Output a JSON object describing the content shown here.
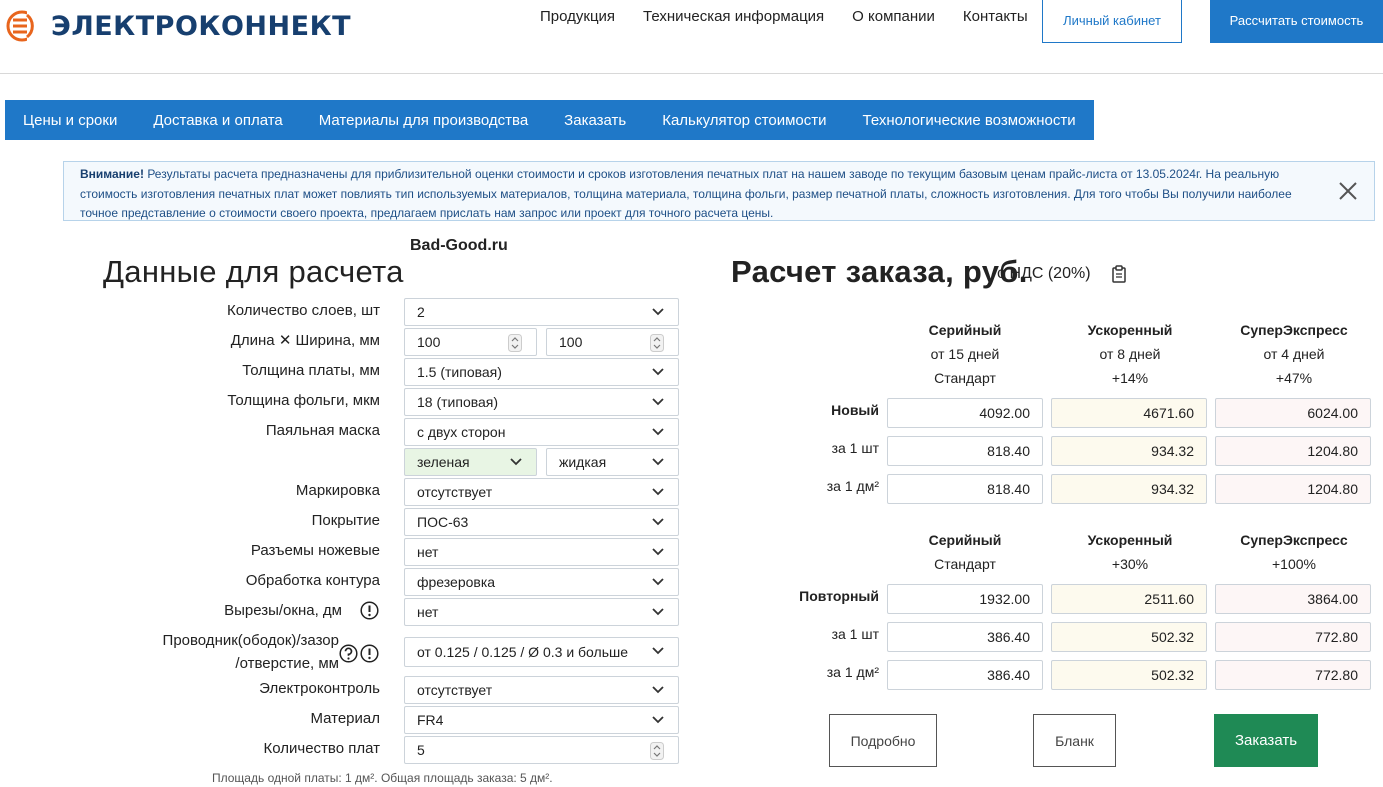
{
  "brand": {
    "name": "ЭЛЕКТРОКОННЕКТ",
    "logo_icon": "logo-mark-icon",
    "color": "#173f6f",
    "accent": "#e8651d"
  },
  "topnav": [
    "Продукция",
    "Техническая информация",
    "О компании",
    "Контакты"
  ],
  "header_buttons": {
    "cabinet": "Личный кабинет",
    "calculate": "Рассчитать стоимость"
  },
  "subnav": [
    "Цены и сроки",
    "Доставка и оплата",
    "Материалы для производства",
    "Заказать",
    "Калькулятор стоимости",
    "Технологические возможности"
  ],
  "alert": {
    "strong": "Внимание!",
    "text": " Результаты расчета предназначены для приблизительной оценки стоимости и сроков изготовления печатных плат на нашем заводе по текущим базовым ценам прайс-листа от 13.05.2024г. На реальную стоимость изготовления печатных плат может повлиять тип используемых материалов, толщина материала, толщина фольги, размер печатной платы, сложность изготовления. Для того чтобы Вы получили наиболее точное представление о стоимости своего проекта, предлагаем прислать нам запрос или проект для точного расчета цены."
  },
  "watermark": "Bad-Good.ru",
  "form": {
    "title": "Данные для расчета",
    "layers_label": "Количество слоев, шт",
    "layers_value": "2",
    "size_label": "Длина ✕ Ширина, мм",
    "length_value": "100",
    "width_value": "100",
    "thickness_label": "Толщина платы, мм",
    "thickness_value": "1.5 (типовая)",
    "foil_label": "Толщина фольги, мкм",
    "foil_value": "18 (типовая)",
    "mask_label": "Паяльная маска",
    "mask_sides_value": "с двух сторон",
    "mask_color_value": "зеленая",
    "mask_type_value": "жидкая",
    "marking_label": "Маркировка",
    "marking_value": "отсутствует",
    "coating_label": "Покрытие",
    "coating_value": "ПОС-63",
    "connectors_label": "Разъемы ножевые",
    "connectors_value": "нет",
    "contour_label": "Обработка контура",
    "contour_value": "фрезеровка",
    "cutouts_label": "Вырезы/окна, дм",
    "cutouts_value": "нет",
    "conductor_label_1": "Проводник(ободок)/зазор",
    "conductor_label_2": "/отверстие, мм",
    "conductor_value": "от 0.125 / 0.125 / Ø 0.3 и больше",
    "etest_label": "Электроконтроль",
    "etest_value": "отсутствует",
    "material_label": "Материал",
    "material_value": "FR4",
    "qty_label": "Количество плат",
    "qty_value": "5",
    "footnote": "Площадь одной платы: 1 дм². Общая площадь заказа: 5 дм²."
  },
  "calc": {
    "title": "Расчет заказа, руб.",
    "vat": "с НДС (20%)",
    "new_columns": [
      {
        "name": "Серийный",
        "term": "от 15 дней",
        "extra": "Стандарт"
      },
      {
        "name": "Ускоренный",
        "term": "от 8 дней",
        "extra": "+14%"
      },
      {
        "name": "СуперЭкспресс",
        "term": "от 4 дней",
        "extra": "+47%"
      }
    ],
    "new_rows": [
      {
        "label": "Новый",
        "values": [
          "4092.00",
          "4671.60",
          "6024.00"
        ]
      },
      {
        "label": "за 1 шт",
        "values": [
          "818.40",
          "934.32",
          "1204.80"
        ]
      },
      {
        "label": "за 1 дм²",
        "values": [
          "818.40",
          "934.32",
          "1204.80"
        ]
      }
    ],
    "repeat_columns": [
      {
        "name": "Серийный",
        "extra": "Стандарт"
      },
      {
        "name": "Ускоренный",
        "extra": "+30%"
      },
      {
        "name": "СуперЭкспресс",
        "extra": "+100%"
      }
    ],
    "repeat_rows": [
      {
        "label": "Повторный",
        "values": [
          "1932.00",
          "2511.60",
          "3864.00"
        ]
      },
      {
        "label": "за 1 шт",
        "values": [
          "386.40",
          "502.32",
          "772.80"
        ]
      },
      {
        "label": "за 1 дм²",
        "values": [
          "386.40",
          "502.32",
          "772.80"
        ]
      }
    ],
    "buttons": {
      "details": "Подробно",
      "blank": "Бланк",
      "order": "Заказать"
    }
  }
}
